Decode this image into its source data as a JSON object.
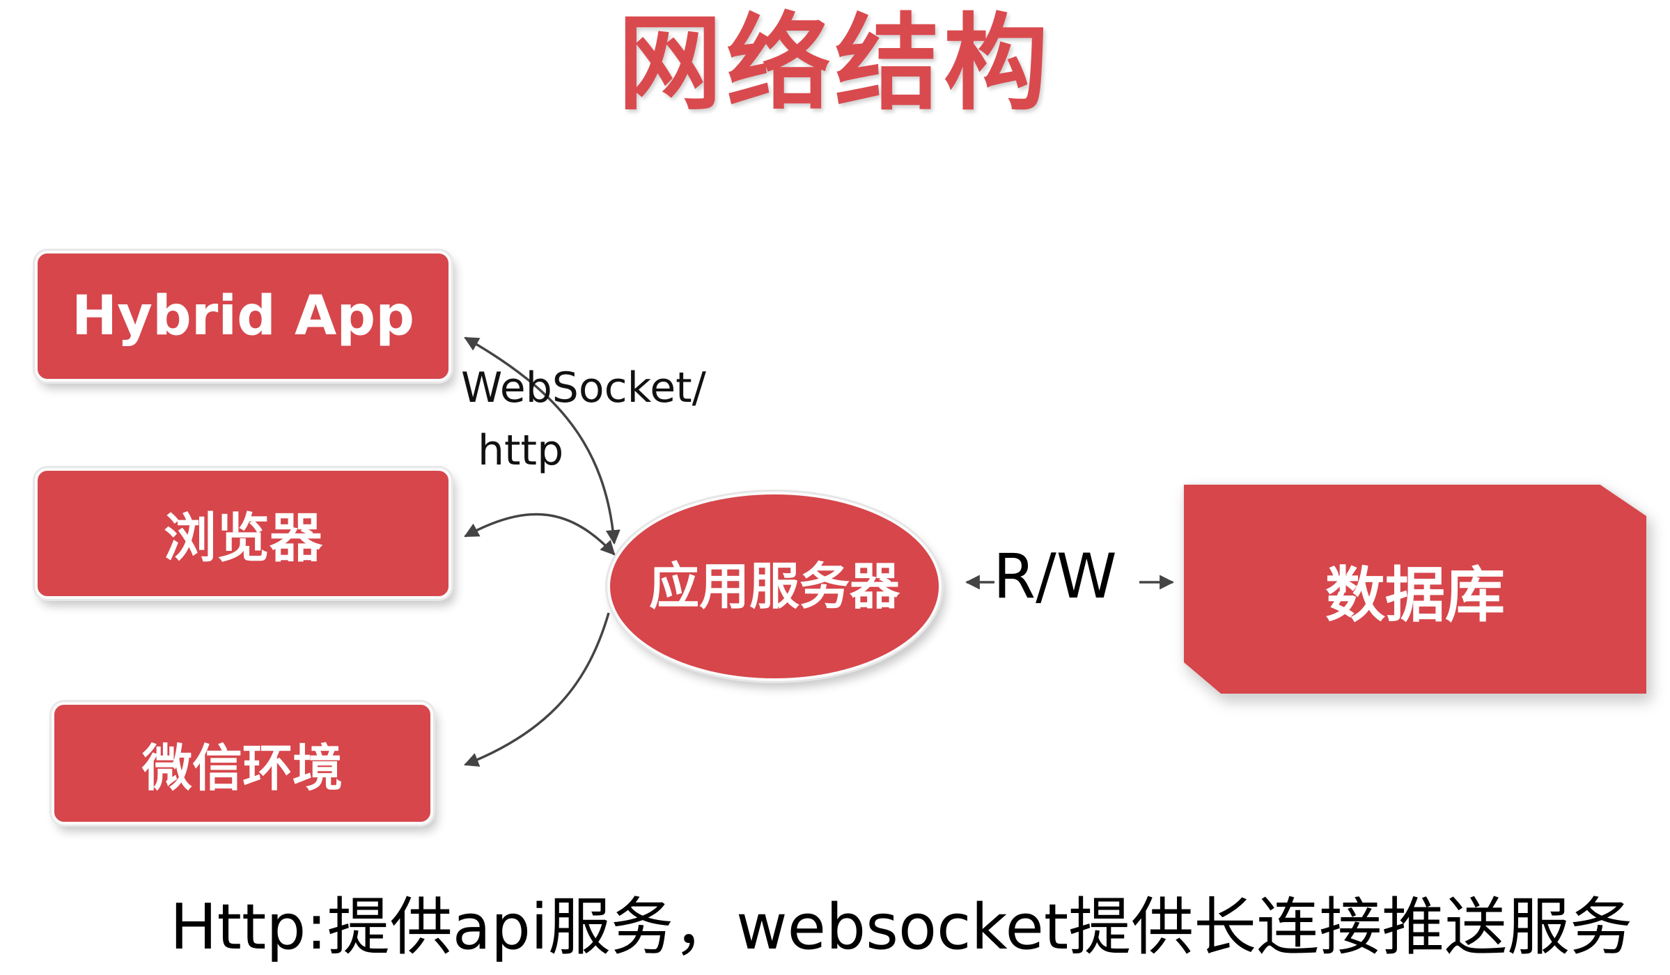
{
  "title": "网络结构",
  "nodes": {
    "hybrid_app": "Hybrid App",
    "browser": "浏览器",
    "wechat": "微信环境",
    "app_server": "应用服务器",
    "database": "数据库"
  },
  "edge_labels": {
    "websocket_line1": "WebSocket/",
    "websocket_line2": "http",
    "read_write": "R/W"
  },
  "footer": "Http:提供api服务，websocket提供长连接推送服务",
  "colors": {
    "node_fill": "#d6464b",
    "title": "#d94a4e",
    "arrow": "#444444"
  }
}
